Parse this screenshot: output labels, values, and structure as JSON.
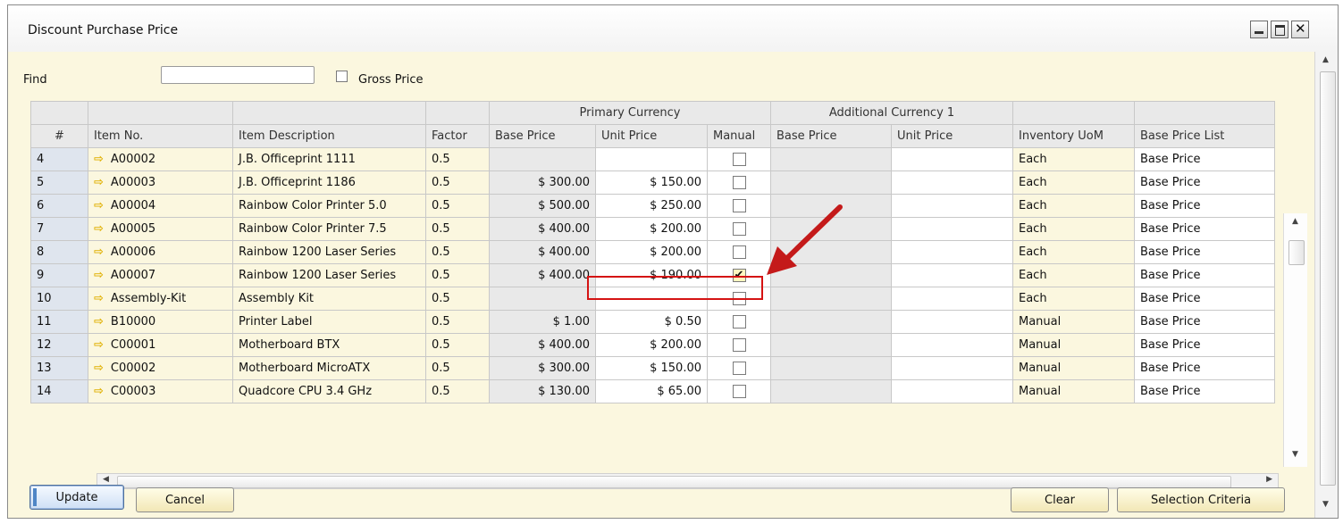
{
  "window": {
    "title": "Discount Purchase Price",
    "controls": [
      "minimize-icon",
      "maximize-icon",
      "close-icon"
    ]
  },
  "filter": {
    "find_label": "Find",
    "find_value": "",
    "gross_price_label": "Gross Price",
    "gross_price_checked": false
  },
  "grid": {
    "group_headers": {
      "primary_currency": "Primary Currency",
      "additional_currency": "Additional Currency 1"
    },
    "columns": [
      "#",
      "Item No.",
      "Item Description",
      "Factor",
      "Base Price",
      "Unit Price",
      "Manual",
      "Base Price",
      "Unit Price",
      "Inventory UoM",
      "Base Price List"
    ],
    "rows": [
      {
        "num": "4",
        "item_no": "A00002",
        "desc": "J.B. Officeprint 1111",
        "factor": "0.5",
        "base_price": "",
        "unit_price": "",
        "manual": false,
        "uom": "Each",
        "price_list": "Base Price"
      },
      {
        "num": "5",
        "item_no": "A00003",
        "desc": "J.B. Officeprint 1186",
        "factor": "0.5",
        "base_price": "$ 300.00",
        "unit_price": "$ 150.00",
        "manual": false,
        "uom": "Each",
        "price_list": "Base Price"
      },
      {
        "num": "6",
        "item_no": "A00004",
        "desc": "Rainbow Color Printer 5.0",
        "factor": "0.5",
        "base_price": "$ 500.00",
        "unit_price": "$ 250.00",
        "manual": false,
        "uom": "Each",
        "price_list": "Base Price"
      },
      {
        "num": "7",
        "item_no": "A00005",
        "desc": "Rainbow Color Printer 7.5",
        "factor": "0.5",
        "base_price": "$ 400.00",
        "unit_price": "$ 200.00",
        "manual": false,
        "uom": "Each",
        "price_list": "Base Price"
      },
      {
        "num": "8",
        "item_no": "A00006",
        "desc": "Rainbow 1200 Laser Series",
        "factor": "0.5",
        "base_price": "$ 400.00",
        "unit_price": "$ 200.00",
        "manual": false,
        "uom": "Each",
        "price_list": "Base Price"
      },
      {
        "num": "9",
        "item_no": "A00007",
        "desc": "Rainbow 1200 Laser Series",
        "factor": "0.5",
        "base_price": "$ 400.00",
        "unit_price": "$ 190.00",
        "manual": true,
        "uom": "Each",
        "price_list": "Base Price"
      },
      {
        "num": "10",
        "item_no": "Assembly-Kit",
        "desc": "Assembly Kit",
        "factor": "0.5",
        "base_price": "",
        "unit_price": "",
        "manual": false,
        "uom": "Each",
        "price_list": "Base Price"
      },
      {
        "num": "11",
        "item_no": "B10000",
        "desc": "Printer Label",
        "factor": "0.5",
        "base_price": "$ 1.00",
        "unit_price": "$ 0.50",
        "manual": false,
        "uom": "Manual",
        "price_list": "Base Price"
      },
      {
        "num": "12",
        "item_no": "C00001",
        "desc": "Motherboard BTX",
        "factor": "0.5",
        "base_price": "$ 400.00",
        "unit_price": "$ 200.00",
        "manual": false,
        "uom": "Manual",
        "price_list": "Base Price"
      },
      {
        "num": "13",
        "item_no": "C00002",
        "desc": "Motherboard MicroATX",
        "factor": "0.5",
        "base_price": "$ 300.00",
        "unit_price": "$ 150.00",
        "manual": false,
        "uom": "Manual",
        "price_list": "Base Price"
      },
      {
        "num": "14",
        "item_no": "C00003",
        "desc": "Quadcore CPU 3.4 GHz",
        "factor": "0.5",
        "base_price": "$ 130.00",
        "unit_price": "$ 65.00",
        "manual": false,
        "uom": "Manual",
        "price_list": "Base Price"
      }
    ],
    "link_arrow_icon": "link-arrow-icon"
  },
  "buttons": {
    "update": "Update",
    "cancel": "Cancel",
    "clear": "Clear",
    "selection_criteria": "Selection Criteria"
  },
  "colors": {
    "window_bg": "#fbf7df",
    "header_bg": "#e9e9e9",
    "rownum_bg": "#dfe5ee",
    "highlight": "#d51313",
    "link_arrow": "#e0b000"
  }
}
